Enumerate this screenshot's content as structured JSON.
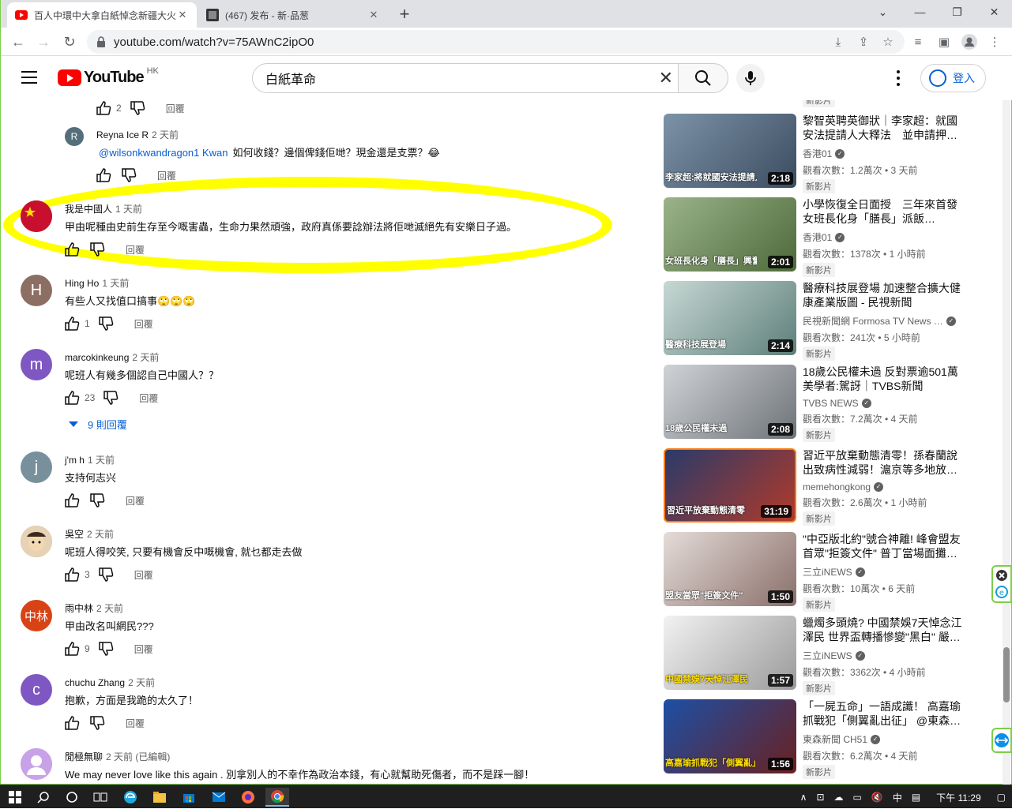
{
  "browser": {
    "tabs": [
      {
        "title": "百人中環中大拿白紙悼念新疆大火",
        "active": true
      },
      {
        "title": "(467) 发布 - 新·品葱",
        "active": false
      }
    ],
    "url": "youtube.com/watch?v=75AWnC2ipO0",
    "window_controls": [
      "⌄",
      "—",
      "❐",
      "✕"
    ]
  },
  "youtube": {
    "logo_text": "YouTube",
    "country_code": "HK",
    "search_value": "白紙革命",
    "signin_label": "登入"
  },
  "comments": [
    {
      "type": "reply-actions",
      "likes": "2",
      "reply_label": "回覆"
    },
    {
      "type": "reply",
      "author": "Reyna Ice R",
      "time": "2 天前",
      "mention": "@wilsonkwandragon1 Kwan",
      "text": "如何收錢？邊個俾錢佢哋？現金還是支票？😂",
      "likes": "",
      "reply_label": "回覆",
      "avatar_letter": "R",
      "avatar_color": "#546e7a"
    },
    {
      "type": "comment",
      "author": "我是中國人",
      "time": "1 天前",
      "text": "甲由呢種由史前生存至今嘅害蟲，生命力果然頑強，政府真係要諗辦法將佢哋滅絕先有安樂日子過。",
      "likes": "",
      "reply_label": "回覆",
      "avatar_letter": "",
      "avatar_color": "#d62828",
      "highlighted": true
    },
    {
      "type": "comment",
      "author": "Hing Ho",
      "time": "1 天前",
      "text": "有些人又找值口搞事🙄🙄🙄",
      "likes": "1",
      "reply_label": "回覆",
      "avatar_letter": "H",
      "avatar_color": "#8d6e63"
    },
    {
      "type": "comment",
      "author": "marcokinkeung",
      "time": "2 天前",
      "text": "呢班人有幾多個認自己中國人？？",
      "likes": "23",
      "reply_label": "回覆",
      "avatar_letter": "m",
      "avatar_color": "#7e57c2",
      "replies_toggle": "9 則回覆"
    },
    {
      "type": "comment",
      "author": "j'm h",
      "time": "1 天前",
      "text": "支持何志兴",
      "likes": "",
      "reply_label": "回覆",
      "avatar_letter": "j",
      "avatar_color": "#78909c"
    },
    {
      "type": "comment",
      "author": "吳空",
      "time": "2 天前",
      "text": "呢班人得咬笑, 只要有機會反中嘅機會, 就乜都走去做",
      "likes": "3",
      "reply_label": "回覆",
      "avatar_letter": "吳",
      "avatar_color": "#a1887f"
    },
    {
      "type": "comment",
      "author": "雨中林",
      "time": "2 天前",
      "text": "甲由改名叫網民???",
      "likes": "9",
      "reply_label": "回覆",
      "avatar_letter": "中林",
      "avatar_color": "#d84315"
    },
    {
      "type": "comment",
      "author": "chuchu Zhang",
      "time": "2 天前",
      "text": "抱歉，方面是我跪的太久了！",
      "likes": "",
      "reply_label": "回覆",
      "avatar_letter": "c",
      "avatar_color": "#7e57c2"
    },
    {
      "type": "comment",
      "author": "閒極無聊",
      "time": "2 天前 (已編輯)",
      "text": "We may never love like this again . 別拿別人的不幸作為政治本錢，有心就幫助死傷者，而不是踩一腳！",
      "likes": "",
      "reply_label": "",
      "avatar_letter": "",
      "avatar_color": "#c8a2e8"
    }
  ],
  "sidebar": {
    "videos": [
      {
        "title": "",
        "channel": "",
        "views": "",
        "badge": "新影片",
        "duration": "",
        "thumb_color": "#2a2a2a",
        "caption": ""
      },
      {
        "title": "黎智英聘英御狀｜李家超：就國安法提請人大釋法　並申請押…",
        "channel": "香港01",
        "verified": true,
        "views": "觀看次數：1.2萬次 • 3 天前",
        "badge": "新影片",
        "duration": "2:18",
        "thumb_color": "#5a6f85",
        "caption": "李家超:將就國安法提請人大釋法"
      },
      {
        "title": "小學恢復全日面授　三年來首發　女班長化身「膳長」派飯…",
        "channel": "香港01",
        "verified": true,
        "views": "觀看次數：1378次 • 1 小時前",
        "badge": "新影片",
        "duration": "2:01",
        "thumb_color": "#6f8a5c",
        "caption": "女班長化身「膳長」興奮"
      },
      {
        "title": "醫療科技展登場 加速整合擴大健康產業版圖 - 民視新聞",
        "channel": "民視新聞網 Formosa TV News …",
        "verified": true,
        "views": "觀看次數：241次 • 5 小時前",
        "badge": "新影片",
        "duration": "2:14",
        "thumb_color": "#8aa4a0",
        "caption": "醫療科技展登場"
      },
      {
        "title": "18歲公民權未過 反對票逾501萬 美學者:駕訝｜TVBS新聞",
        "channel": "TVBS NEWS",
        "verified": true,
        "views": "觀看次數：7.2萬次 • 4 天前",
        "badge": "新影片",
        "duration": "2:08",
        "thumb_color": "#9aa0a6",
        "caption": "18歲公民權未過"
      },
      {
        "title": "習近平放棄動態清零！孫春蘭說出致病性減弱！滬京等多地放…",
        "channel": "memehongkong",
        "verified": true,
        "views": "觀看次數：2.6萬次 • 1 小時前",
        "badge": "新影片",
        "duration": "31:19",
        "thumb_color": "#b13a2a",
        "caption": "習近平放棄動態清零"
      },
      {
        "title": "\"中亞版北約\"號合神離! 峰會盟友首眾\"拒簽文件\" 普丁當場面攤…",
        "channel": "三立iNEWS",
        "verified": true,
        "views": "觀看次數：10萬次 • 6 天前",
        "badge": "新影片",
        "duration": "1:50",
        "thumb_color": "#c9c2c0",
        "caption": "盟友當眾\"拒簽文件\""
      },
      {
        "title": "蠟燭多頭燒? 中國禁娛7天悼念江澤民 世界盃轉播慘變\"黑白\" 嚴…",
        "channel": "三立iNEWS",
        "verified": true,
        "views": "觀看次數：3362次 • 4 小時前",
        "badge": "新影片",
        "duration": "1:57",
        "thumb_color": "#e8e8e8",
        "caption": "中國禁娛7天悼江澤民"
      },
      {
        "title": "「一屍五命」一語成讖！ 高嘉瑜抓戰犯「側翼亂出征」 @東森…",
        "channel": "東森新聞 CH51",
        "verified": true,
        "views": "觀看次數：6.2萬次 • 4 天前",
        "badge": "新影片",
        "duration": "1:56",
        "thumb_color": "#1d4fa5",
        "caption": "高嘉瑜抓戰犯「側翼亂」"
      }
    ]
  },
  "taskbar": {
    "time": "下午 11:29",
    "ime": "中"
  }
}
